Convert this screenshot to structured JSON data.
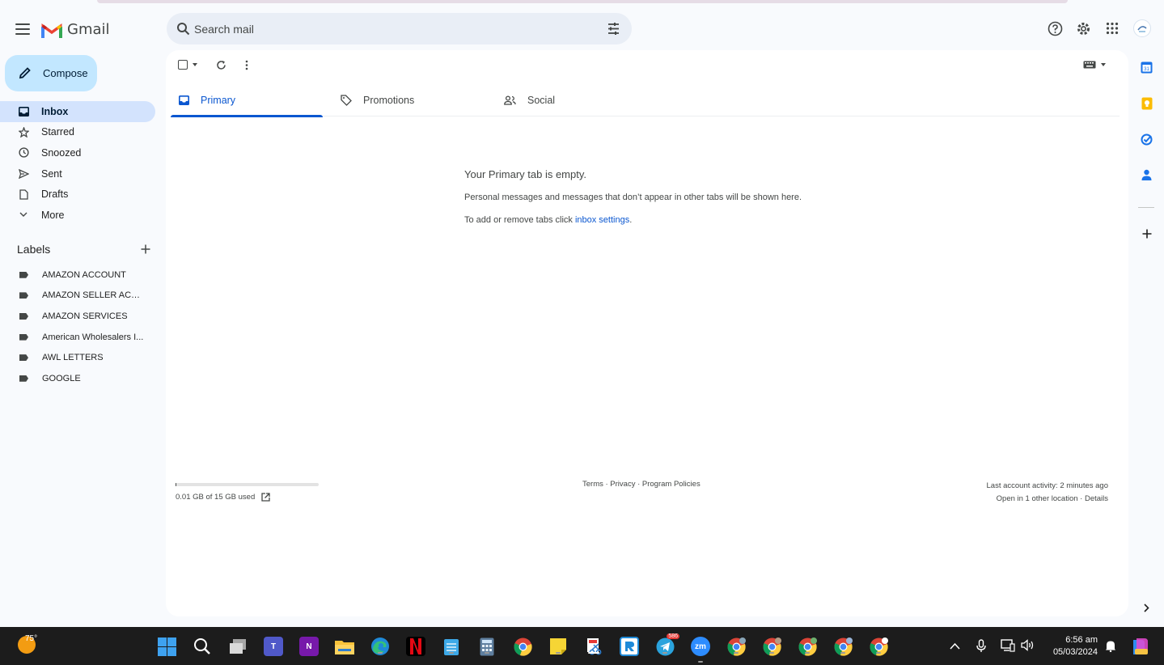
{
  "app": {
    "name": "Gmail"
  },
  "search": {
    "placeholder": "Search mail"
  },
  "compose": {
    "label": "Compose"
  },
  "nav": [
    {
      "label": "Inbox",
      "icon": "inbox-icon",
      "active": true
    },
    {
      "label": "Starred",
      "icon": "star-icon"
    },
    {
      "label": "Snoozed",
      "icon": "clock-icon"
    },
    {
      "label": "Sent",
      "icon": "send-icon"
    },
    {
      "label": "Drafts",
      "icon": "draft-icon"
    },
    {
      "label": "More",
      "icon": "chevron-down-icon"
    }
  ],
  "labels": {
    "title": "Labels",
    "items": [
      "AMAZON ACCOUNT",
      "AMAZON SELLER ACCE...",
      "AMAZON SERVICES",
      "American Wholesalers I...",
      "AWL LETTERS",
      "GOOGLE"
    ]
  },
  "tabs": [
    "Primary",
    "Promotions",
    "Social"
  ],
  "empty_state": {
    "title": "Your Primary tab is empty.",
    "description": "Personal messages and messages that don’t appear in other tabs will be shown here.",
    "hint_prefix": "To add or remove tabs click ",
    "hint_link": "inbox settings",
    "hint_suffix": "."
  },
  "footer": {
    "storage": "0.01 GB of 15 GB used",
    "storage_fraction": 0.001,
    "links": "Terms · Privacy · Program Policies",
    "activity": "Last account activity: 2 minutes ago",
    "details": "Open in 1 other location · Details"
  },
  "taskbar": {
    "weather": "75°",
    "telegram_badge": "586",
    "zoom_label": "zm",
    "teams_label": "T",
    "onenote_label": "N",
    "time": "6:56 am",
    "date": "05/03/2024"
  },
  "colors": {
    "accent": "#0b57d0",
    "compose": "#c2e7ff",
    "active_nav": "#d3e3fd"
  }
}
